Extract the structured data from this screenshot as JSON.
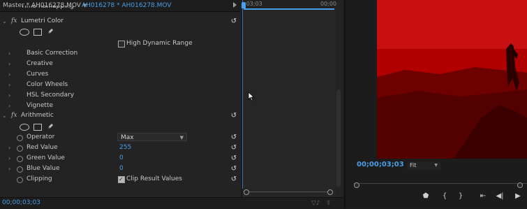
{
  "tabs": {
    "master_label": "Master * AH016278.MOV",
    "clip_label": "AH016278 * AH016278.MOV",
    "dropdown_glyph": "▼"
  },
  "effects": {
    "time_remapping": "Time Remapping",
    "lumetri": {
      "name": "Lumetri Color",
      "hdr_label": "High Dynamic Range",
      "hdr_checked": false,
      "sections": [
        "Basic Correction",
        "Creative",
        "Curves",
        "Color Wheels",
        "HSL Secondary",
        "Vignette"
      ]
    },
    "arithmetic": {
      "name": "Arithmetic",
      "operator_label": "Operator",
      "operator_value": "Max",
      "red_label": "Red Value",
      "red_value": "255",
      "green_label": "Green Value",
      "green_value": "0",
      "blue_label": "Blue Value",
      "blue_value": "0",
      "clipping_label": "Clipping",
      "clip_result_label": "Clip Result Values",
      "clip_result_checked": true
    }
  },
  "mini_timeline": {
    "start_tc": ";03;03",
    "end_tc": "00;00"
  },
  "footer": {
    "timecode": "00;00;03;03"
  },
  "monitor": {
    "timecode": "00;00;03;03",
    "zoom": "Fit",
    "video_tint": "#a00000"
  },
  "colors": {
    "accent_blue": "#4a9ee8",
    "panel_bg": "#232323"
  }
}
